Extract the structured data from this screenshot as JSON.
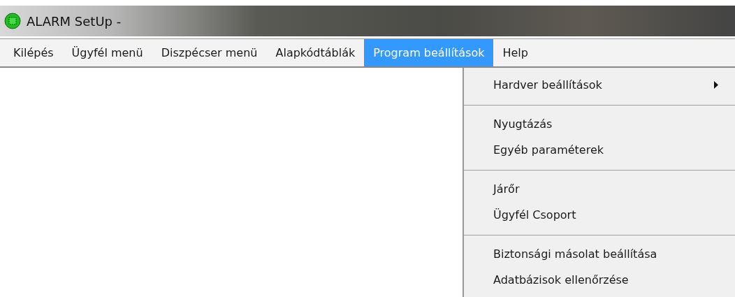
{
  "window": {
    "title": "ALARM SetUp -"
  },
  "menu_bar": [
    {
      "label": "Kilépés",
      "selected": false
    },
    {
      "label": "Ügyfél menü",
      "selected": false
    },
    {
      "label": "Diszpécser menü",
      "selected": false
    },
    {
      "label": "Alapkódtáblák",
      "selected": false
    },
    {
      "label": "Program beállítások",
      "selected": true
    },
    {
      "label": "Help",
      "selected": false
    }
  ],
  "dropdown": [
    {
      "kind": "item",
      "label": "Hardver beállítások",
      "submenu": true
    },
    {
      "kind": "separator"
    },
    {
      "kind": "item",
      "label": "Nyugtázás",
      "submenu": false
    },
    {
      "kind": "item",
      "label": "Egyéb paraméterek",
      "submenu": false
    },
    {
      "kind": "separator"
    },
    {
      "kind": "item",
      "label": "Járőr",
      "submenu": false
    },
    {
      "kind": "item",
      "label": "Ügyfél Csoport",
      "submenu": false
    },
    {
      "kind": "separator"
    },
    {
      "kind": "item",
      "label": "Biztonsági másolat beállítása",
      "submenu": false
    },
    {
      "kind": "item",
      "label": "Adatbázisok ellenőrzése",
      "submenu": false
    }
  ]
}
